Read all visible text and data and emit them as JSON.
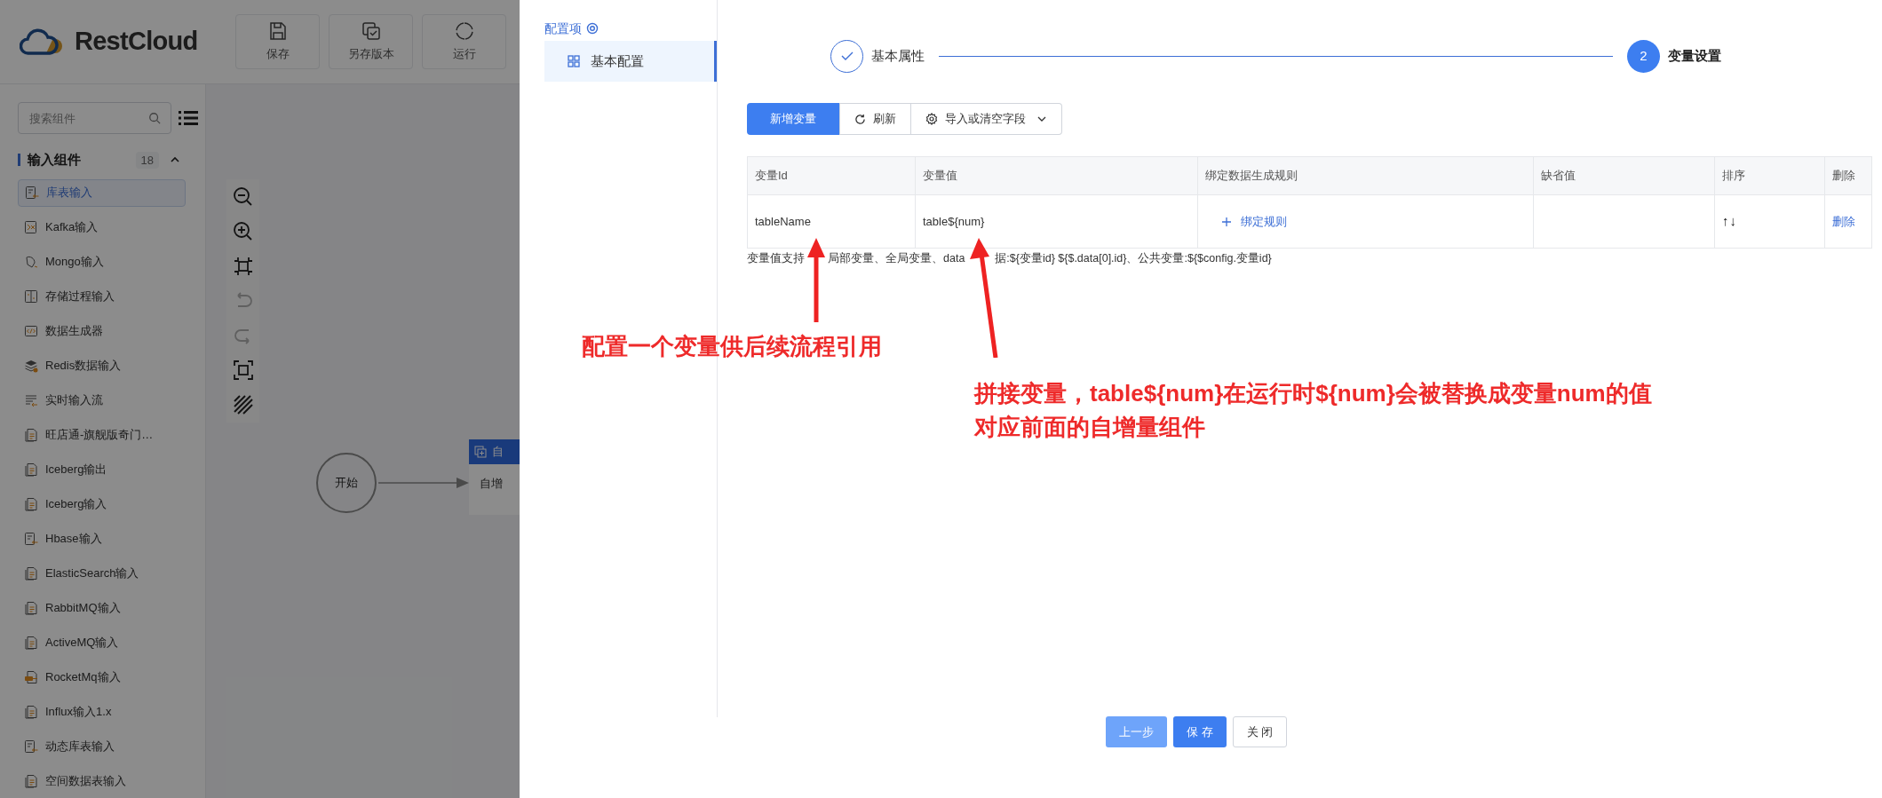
{
  "app": {
    "logo": "RestCloud",
    "toolbar": [
      {
        "label": "保存",
        "kind": "save"
      },
      {
        "label": "另存版本",
        "kind": "save-as"
      },
      {
        "label": "运行",
        "kind": "run"
      }
    ]
  },
  "sidebar": {
    "search": {
      "placeholder": "搜索组件"
    },
    "group": {
      "title": "输入组件",
      "count": "18",
      "expanded": true
    },
    "items": [
      {
        "label": "库表输入",
        "kind": "table",
        "selected": true
      },
      {
        "label": "Kafka输入",
        "kind": "kafka",
        "selected": false
      },
      {
        "label": "Mongo输入",
        "kind": "mongo",
        "selected": false
      },
      {
        "label": "存储过程输入",
        "kind": "procedure",
        "selected": false
      },
      {
        "label": "数据生成器",
        "kind": "generator",
        "selected": false
      },
      {
        "label": "Redis数据输入",
        "kind": "redis",
        "selected": false
      },
      {
        "label": "实时输入流",
        "kind": "stream",
        "selected": false
      },
      {
        "label": "旺店通-旗舰版奇门…",
        "kind": "file",
        "selected": false
      },
      {
        "label": "Iceberg输出",
        "kind": "file",
        "selected": false
      },
      {
        "label": "Iceberg输入",
        "kind": "file",
        "selected": false
      },
      {
        "label": "Hbase输入",
        "kind": "table",
        "selected": false
      },
      {
        "label": "ElasticSearch输入",
        "kind": "file",
        "selected": false
      },
      {
        "label": "RabbitMQ输入",
        "kind": "file",
        "selected": false
      },
      {
        "label": "ActiveMQ输入",
        "kind": "file",
        "selected": false
      },
      {
        "label": "RocketMq输入",
        "kind": "rocket",
        "selected": false
      },
      {
        "label": "Influx输入1.x",
        "kind": "file",
        "selected": false
      },
      {
        "label": "动态库表输入",
        "kind": "table",
        "selected": false
      },
      {
        "label": "空间数据表输入",
        "kind": "file",
        "selected": false
      }
    ]
  },
  "canvas": {
    "tools": [
      {
        "kind": "zoom-out",
        "disabled": false
      },
      {
        "kind": "zoom-in",
        "disabled": false
      },
      {
        "kind": "fit",
        "disabled": false
      },
      {
        "kind": "undo",
        "disabled": true
      },
      {
        "kind": "redo",
        "disabled": true
      },
      {
        "kind": "focus",
        "disabled": false
      },
      {
        "kind": "hatch",
        "disabled": false
      }
    ],
    "start_node": "开始",
    "node": {
      "header": "自",
      "body": "自增"
    }
  },
  "drawer": {
    "section_title": "配置项",
    "nav_items": [
      {
        "label": "基本配置",
        "selected": true
      }
    ],
    "steps": [
      {
        "label": "基本属性",
        "done": true
      },
      {
        "label": "变量设置",
        "number": "2",
        "done": false
      }
    ],
    "actions": [
      {
        "label": "新增变量",
        "kind": "primary"
      },
      {
        "label": "刷新",
        "kind": "refresh"
      },
      {
        "label": "导入或清空字段",
        "kind": "menu"
      }
    ],
    "table": {
      "columns": [
        "变量Id",
        "变量值",
        "绑定数据生成规则",
        "缺省值",
        "排序",
        "删除"
      ],
      "rows": [
        {
          "variable_id": "tableName",
          "value": "table${num}",
          "rule_link": "绑定规则",
          "sort": "↑↓",
          "delete": "删除"
        }
      ]
    },
    "hint_parts": [
      "变量值支持",
      "局部变量、全局变量、data",
      "据:${变量id} ${$.data[0].id}、公共变量:${$config.变量id}"
    ],
    "annotations": [
      {
        "lines": [
          "配置一个变量供后续流程引用"
        ]
      },
      {
        "lines": [
          "拼接变量，table${num}在运行时${num}会被替换成变量num的值",
          "对应前面的自增量组件"
        ]
      }
    ],
    "footer": [
      {
        "label": "上一步",
        "kind": "secondary"
      },
      {
        "label": "保 存",
        "kind": "primary"
      },
      {
        "label": "关 闭",
        "kind": "default"
      }
    ]
  }
}
